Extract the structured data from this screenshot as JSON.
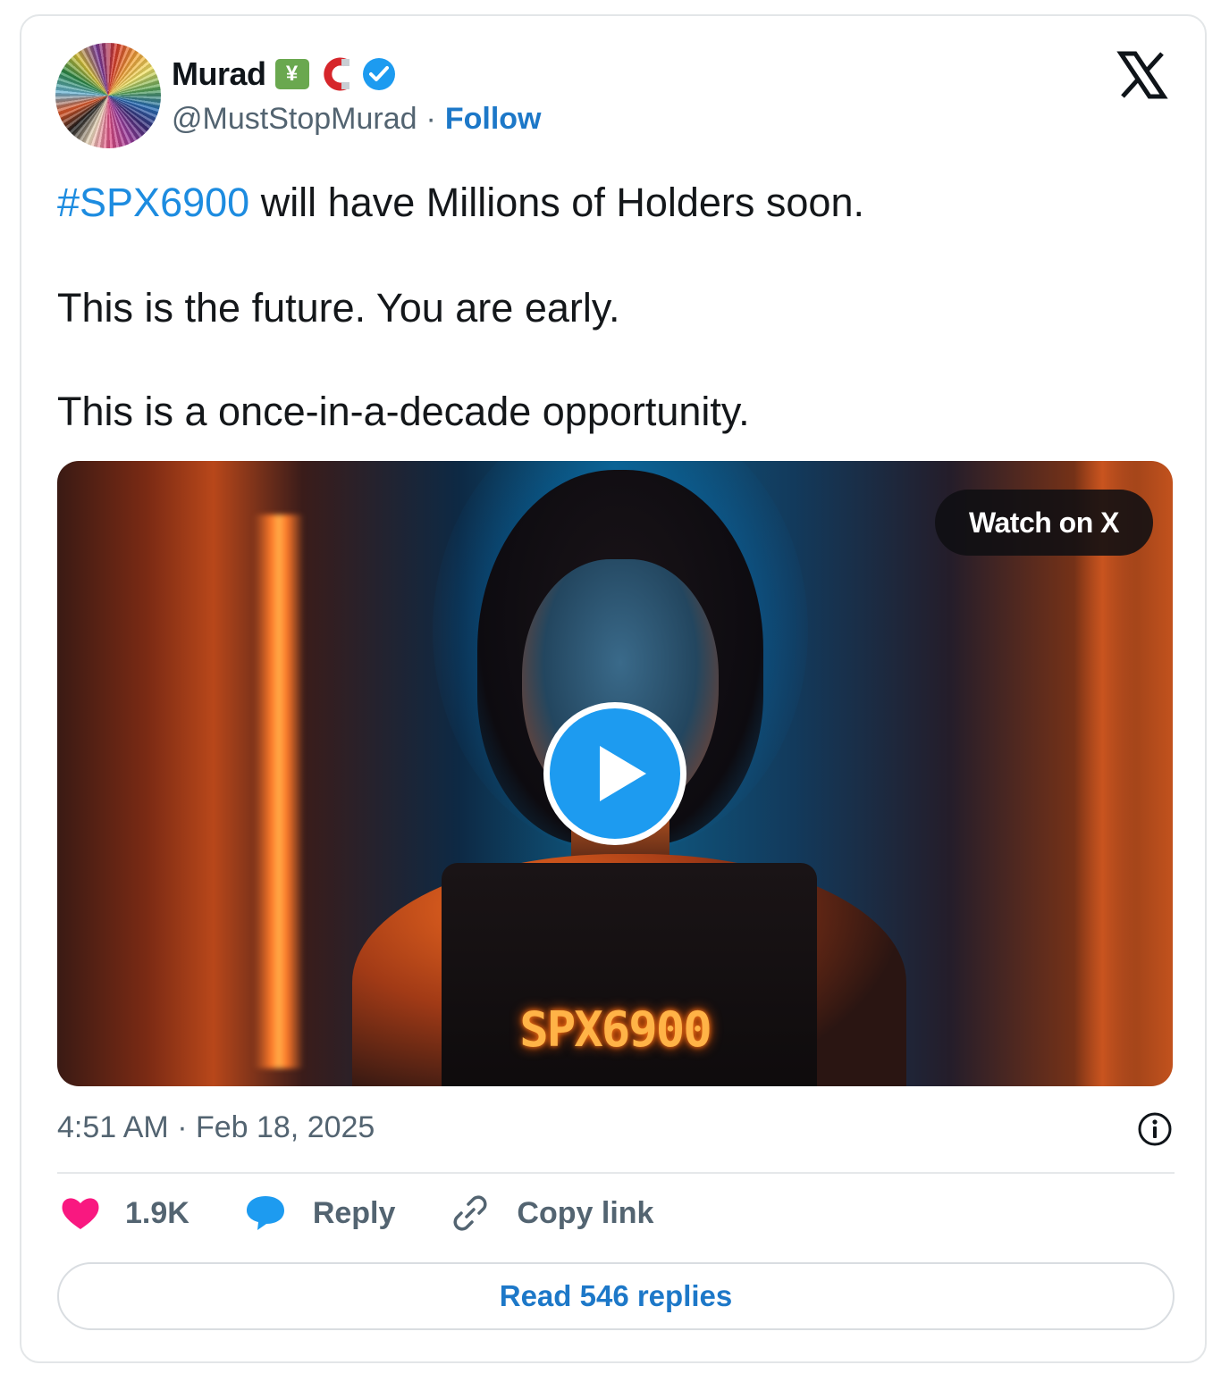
{
  "author": {
    "name": "Murad",
    "handle": "@MustStopMurad",
    "separator": "·",
    "follow_label": "Follow",
    "badges": [
      "chart-yen-emoji-icon",
      "magnet-emoji-icon",
      "verified-badge-icon"
    ]
  },
  "platform_logo": "x-logo-icon",
  "tweet": {
    "hashtag": "#SPX6900",
    "line1_rest": " will have Millions of Holders soon.",
    "line2": "This is the future. You are early.",
    "line3": "This is a once-in-a-decade opportunity."
  },
  "media": {
    "watch_label": "Watch on X",
    "overlay_text": "SPX6900",
    "play_icon": "play-icon"
  },
  "timestamp": "4:51 AM · Feb 18, 2025",
  "actions": {
    "like_count": "1.9K",
    "reply_label": "Reply",
    "copy_label": "Copy link"
  },
  "read_replies_label": "Read 546 replies",
  "colors": {
    "link_blue": "#1d78c8",
    "hashtag_blue": "#1d8ce0",
    "heart_pink": "#f91880",
    "reply_blue": "#1d9bf0",
    "muted_gray": "#536471"
  }
}
